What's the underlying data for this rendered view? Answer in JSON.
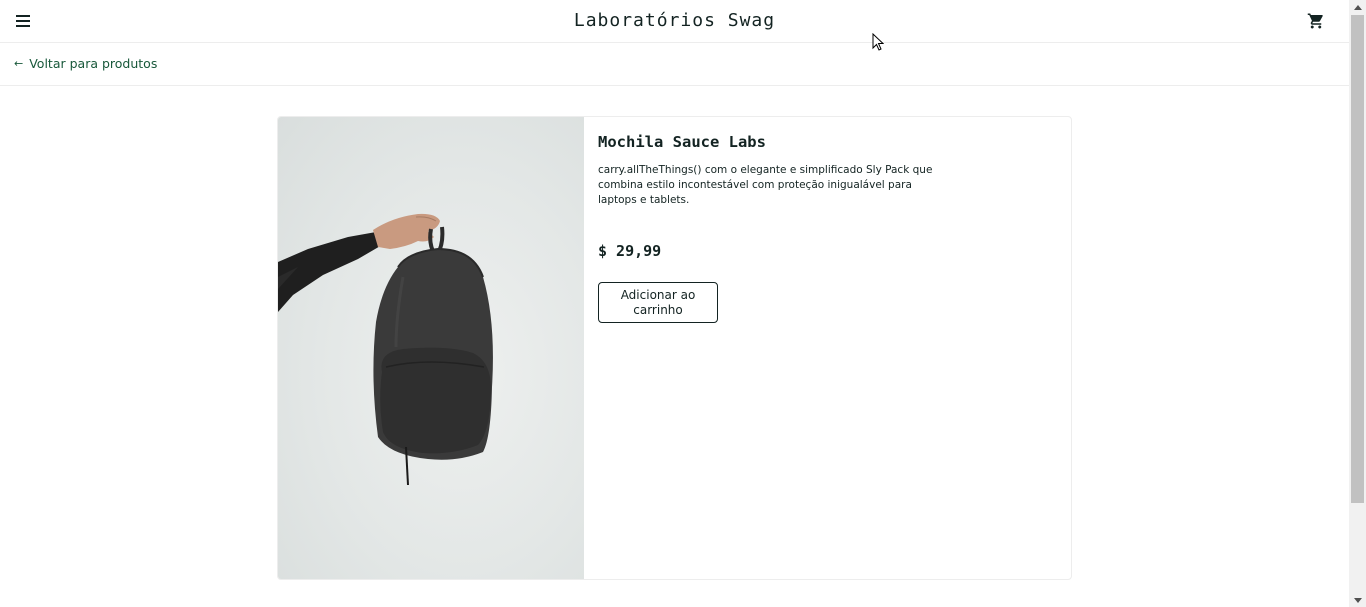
{
  "header": {
    "title": "Laboratórios Swag",
    "menu_icon": "hamburger-menu-icon",
    "cart_icon": "shopping-cart-icon"
  },
  "subheader": {
    "back_label": "Voltar para produtos",
    "back_icon": "arrow-left-icon"
  },
  "product": {
    "name": "Mochila Sauce Labs",
    "description": "carry.allTheThings() com o elegante e simplificado Sly Pack que combina estilo incontestável com proteção inigualável para laptops e tablets.",
    "price": "$ 29,99",
    "add_to_cart_label": "Adicionar ao carrinho"
  },
  "colors": {
    "accent_green": "#18583a",
    "text_dark": "#132322",
    "border": "#ededed"
  }
}
